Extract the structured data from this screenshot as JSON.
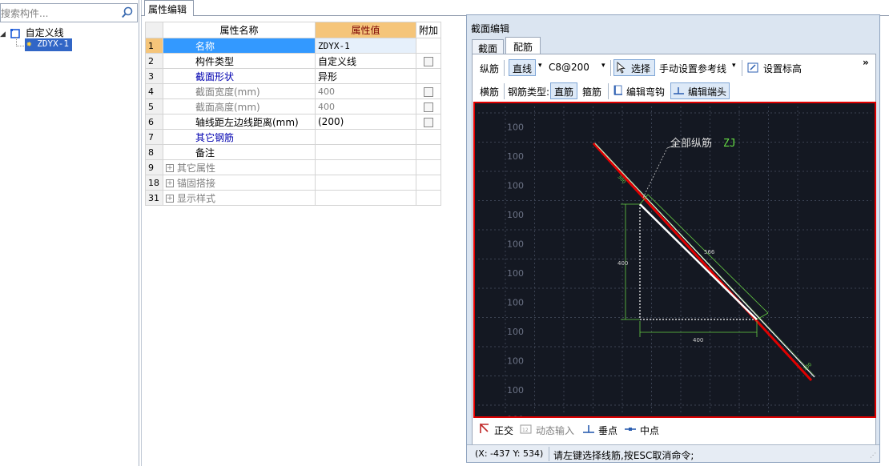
{
  "search": {
    "placeholder": "搜索构件..."
  },
  "tree": {
    "root": "自定义线",
    "child": "ZDYX-1"
  },
  "prop_tab": "属性编辑",
  "grid": {
    "headers": [
      "属性名称",
      "属性值",
      "附加"
    ],
    "rows": [
      {
        "num": "1",
        "name": "名称",
        "value": "ZDYX-1",
        "check": false
      },
      {
        "num": "2",
        "name": "构件类型",
        "value": "自定义线",
        "check": true
      },
      {
        "num": "3",
        "name": "截面形状",
        "value": "异形",
        "check": false
      },
      {
        "num": "4",
        "name": "截面宽度(mm)",
        "value": "400",
        "check": true
      },
      {
        "num": "5",
        "name": "截面高度(mm)",
        "value": "400",
        "check": true
      },
      {
        "num": "6",
        "name": "轴线距左边线距离(mm)",
        "value": "(200)",
        "check": true
      },
      {
        "num": "7",
        "name": "其它钢筋",
        "value": "",
        "check": false
      },
      {
        "num": "8",
        "name": "备注",
        "value": "",
        "check": false
      },
      {
        "num": "9",
        "name": "其它属性",
        "value": "",
        "check": false
      },
      {
        "num": "18",
        "name": "锚固搭接",
        "value": "",
        "check": false
      },
      {
        "num": "31",
        "name": "显示样式",
        "value": "",
        "check": false
      }
    ]
  },
  "dialog": {
    "title": "截面编辑",
    "tabs": [
      "截面",
      "配筋"
    ],
    "row1": {
      "label": "纵筋",
      "line_btn": "直线",
      "rebar_value": "C8@200",
      "select": "选择",
      "manual_ref": "手动设置参考线",
      "set_elev": "设置标高",
      "more": "»"
    },
    "row2": {
      "label": "横筋",
      "type_label": "钢筋类型:",
      "straight": "直筋",
      "stirrup": "箍筋",
      "edit_hook": "编辑弯钩",
      "edit_end": "编辑端头"
    },
    "canvas": {
      "axis_labels": [
        "100",
        "100",
        "100",
        "100",
        "100",
        "100",
        "100",
        "100",
        "100",
        "100",
        "100",
        "100",
        "100",
        "100",
        "100",
        "100"
      ],
      "annotation": "全部纵筋",
      "annotation_code": "ZJ",
      "dim_vertical": "400",
      "dim_horizontal": "400",
      "dim_diagonal": "566",
      "small_label_a": "300",
      "small_label_b": "100"
    },
    "bottom": {
      "ortho": "正交",
      "dynamic": "动态输入",
      "perp": "垂点",
      "mid": "中点"
    },
    "status": {
      "coord": "(X: -437 Y: 534)",
      "message": "请左键选择线筋,按ESC取消命令;"
    },
    "colors": {
      "accent_red": "#e00000",
      "dim_green": "#66cc44",
      "canvas_bg": "#141822"
    }
  }
}
